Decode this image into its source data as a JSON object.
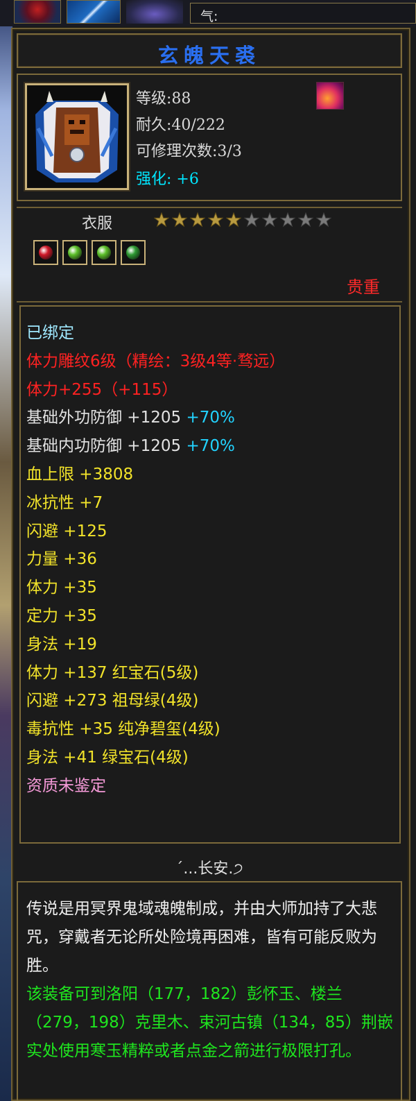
{
  "top_bar": {
    "qi_label": "气:"
  },
  "item": {
    "name": "玄魄天裘",
    "level": "等级:88",
    "durability": "耐久:40/222",
    "repair": "可修理次数:3/3",
    "enhance": "强化: +6",
    "type": "衣服",
    "stars_filled": 5,
    "stars_total": 10,
    "rarity": "贵重",
    "gems": [
      {
        "name": "red-gem",
        "color": "#d01a2a"
      },
      {
        "name": "green-gem",
        "color": "#5cbf2a"
      },
      {
        "name": "green-gem",
        "color": "#5cbf2a"
      },
      {
        "name": "jade-gem",
        "color": "#2f9a34"
      }
    ]
  },
  "attributes": {
    "bound": "已绑定",
    "engrave": "体力雕纹6级（精绘：3级4等·骛远）",
    "vit_main": "体力+255（+115）",
    "ext_def_label": "基础外功防御 +1205",
    "ext_def_pct": "+70%",
    "int_def_label": "基础内功防御 +1205",
    "int_def_pct": "+70%",
    "hp": "血上限 +3808",
    "ice": "冰抗性 +7",
    "dodge": "闪避 +125",
    "str": "力量 +36",
    "vit": "体力 +35",
    "focus": "定力 +35",
    "agi": "身法 +19",
    "gem1": "体力 +137 红宝石(5级)",
    "gem2": "闪避 +273 祖母绿(4级)",
    "gem3": "毒抗性 +35 纯净碧玺(4级)",
    "gem4": "身法 +41 绿宝石(4级)",
    "quality": "资质未鉴定"
  },
  "location": "´...长安.੭",
  "description": {
    "lore": "传说是用冥界鬼域魂魄制成，并由大师加持了大悲咒，穿戴者无论所处险境再困难，皆有可能反败为胜。",
    "howto": "该装备可到洛阳（177，182）彭怀玉、楼兰（279，198）克里木、束河古镇（134，85）荆嵌实处使用寒玉精粹或者点金之箭进行极限打孔。"
  },
  "colors": {
    "title": "#2a6ff0",
    "frame_border": "#7c6a3a",
    "rarity": "#ff2a2a",
    "enhance": "#00e6ff",
    "attribute_red": "#ff2222",
    "attribute_yellow": "#f2e32a",
    "attribute_pct": "#22d3ff",
    "quality_pink": "#f59ad8",
    "howto_green": "#1fe61f"
  }
}
